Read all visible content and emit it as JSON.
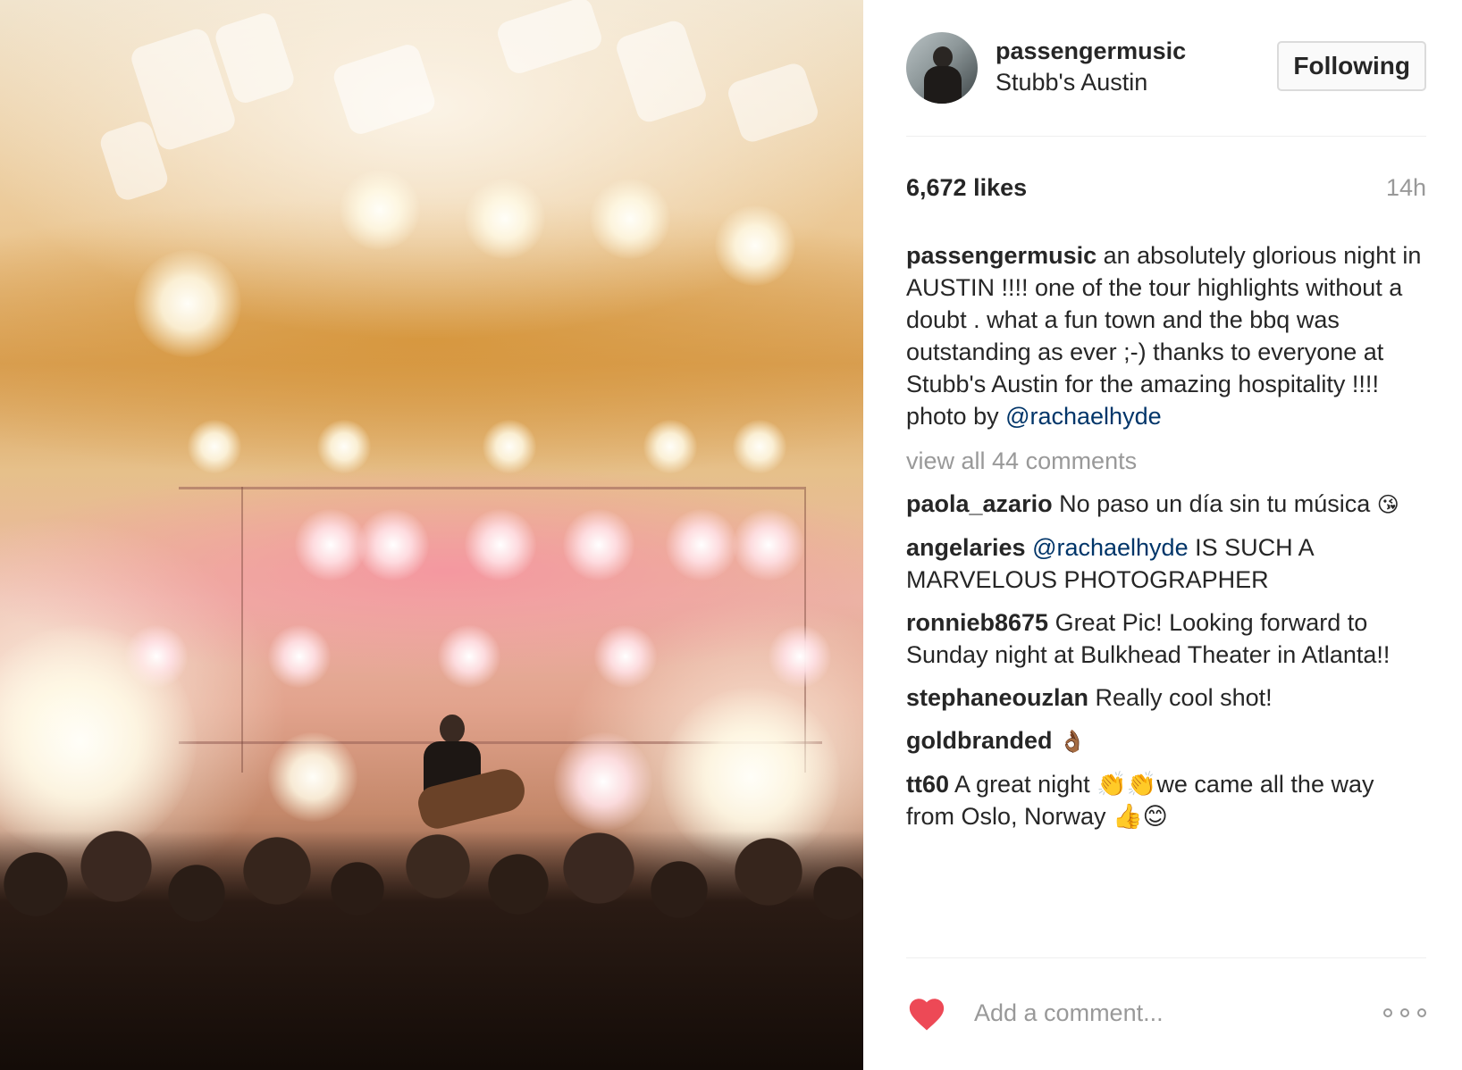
{
  "post": {
    "username": "passengermusic",
    "location": "Stubb's Austin",
    "follow_label": "Following",
    "likes": "6,672 likes",
    "time_ago": "14h"
  },
  "caption": {
    "user": "passengermusic",
    "text": " an absolutely glorious night in AUSTIN !!!! one of the tour highlights without a doubt . what a fun town and the bbq was outstanding as ever ;-) thanks to everyone at Stubb's Austin for the amazing hospitality !!!! photo by ",
    "mention": "@rachaelhyde"
  },
  "view_all_comments": "view all 44 comments",
  "comments": [
    {
      "user": "paola_azario",
      "text": " No paso un día sin tu música ",
      "emoji": "😘"
    },
    {
      "user": "angelaries",
      "mention": " @rachaelhyde",
      "text": " IS SUCH A MARVELOUS PHOTOGRAPHER"
    },
    {
      "user": "ronnieb8675",
      "text": " Great Pic! Looking forward to Sunday night at Bulkhead Theater in Atlanta!!"
    },
    {
      "user": "stephaneouzlan",
      "text": " Really cool shot!"
    },
    {
      "user": "goldbranded",
      "text": " ",
      "emoji": "👌🏾"
    },
    {
      "user": "tt60",
      "text": " A great night 👏👏we came all the way from Oslo, Norway 👍😊"
    }
  ],
  "add_comment": {
    "placeholder": "Add a comment..."
  },
  "icons": {
    "like": "heart-icon",
    "more": "more-options-icon"
  },
  "colors": {
    "heart": "#ed4956",
    "mention": "#003569",
    "muted": "#999999"
  }
}
